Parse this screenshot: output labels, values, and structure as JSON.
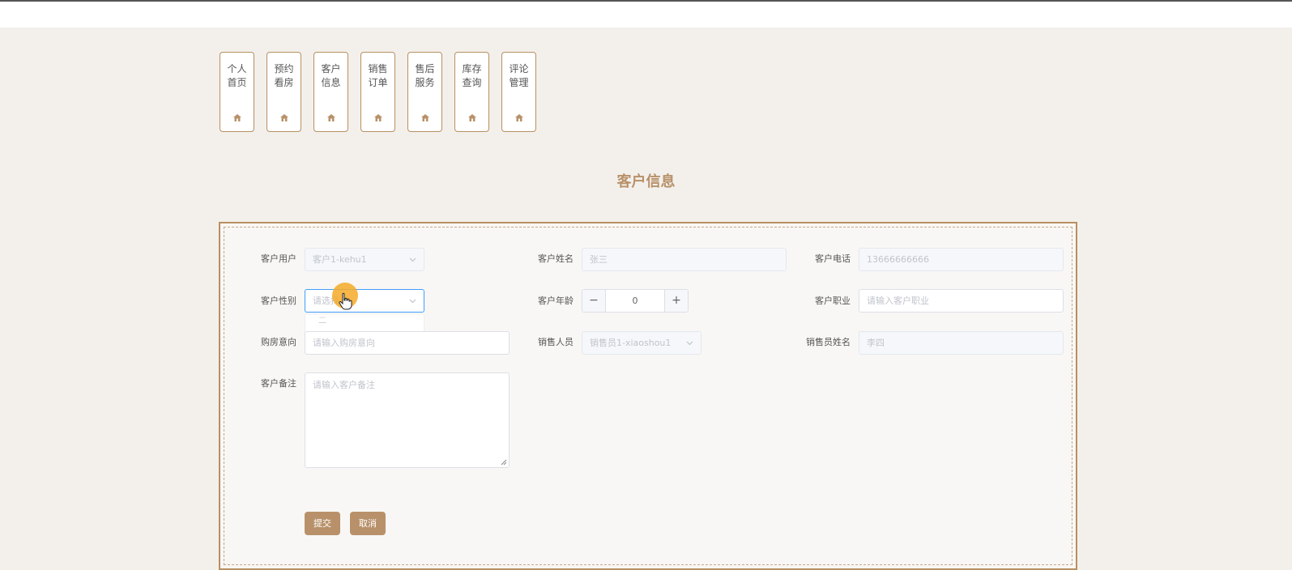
{
  "nav": {
    "items": [
      {
        "label": "个人首页"
      },
      {
        "label": "预约看房"
      },
      {
        "label": "客户信息"
      },
      {
        "label": "销售订单"
      },
      {
        "label": "售后服务"
      },
      {
        "label": "库存查询"
      },
      {
        "label": "评论管理"
      }
    ]
  },
  "page": {
    "title": "客户信息"
  },
  "form": {
    "kehu_user": {
      "label": "客户用户",
      "value": "客户1-kehu1"
    },
    "kehu_name": {
      "label": "客户姓名",
      "value": "张三"
    },
    "kehu_phone": {
      "label": "客户电话",
      "value": "13666666666"
    },
    "kehu_gender": {
      "label": "客户性别",
      "placeholder": "请选择",
      "dropdown_option": "二"
    },
    "kehu_age": {
      "label": "客户年龄",
      "value": "0",
      "minus": "−",
      "plus": "+"
    },
    "kehu_job": {
      "label": "客户职业",
      "placeholder": "请输入客户职业"
    },
    "intent": {
      "label": "购房意向",
      "placeholder": "请输入购房意向"
    },
    "sales_person": {
      "label": "销售人员",
      "value": "销售员1-xiaoshou1"
    },
    "sales_name": {
      "label": "销售员姓名",
      "value": "李四"
    },
    "remark": {
      "label": "客户备注",
      "placeholder": "请输入客户备注"
    },
    "submit_label": "提交",
    "cancel_label": "取消"
  },
  "colors": {
    "accent": "#b8916a",
    "focus": "#409eff",
    "cursor_highlight": "#f5aa28"
  }
}
